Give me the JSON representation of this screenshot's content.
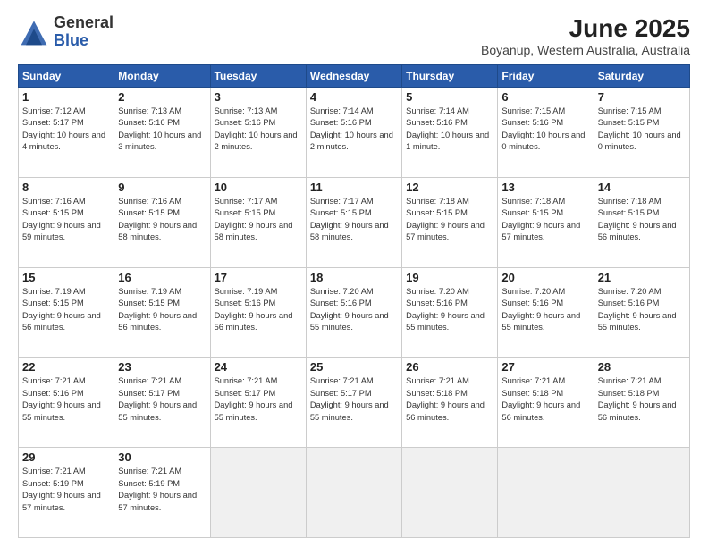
{
  "header": {
    "logo_general": "General",
    "logo_blue": "Blue",
    "month_year": "June 2025",
    "location": "Boyanup, Western Australia, Australia"
  },
  "days_of_week": [
    "Sunday",
    "Monday",
    "Tuesday",
    "Wednesday",
    "Thursday",
    "Friday",
    "Saturday"
  ],
  "weeks": [
    [
      {
        "day": 1,
        "sunrise": "7:12 AM",
        "sunset": "5:17 PM",
        "daylight": "10 hours and 4 minutes."
      },
      {
        "day": 2,
        "sunrise": "7:13 AM",
        "sunset": "5:16 PM",
        "daylight": "10 hours and 3 minutes."
      },
      {
        "day": 3,
        "sunrise": "7:13 AM",
        "sunset": "5:16 PM",
        "daylight": "10 hours and 2 minutes."
      },
      {
        "day": 4,
        "sunrise": "7:14 AM",
        "sunset": "5:16 PM",
        "daylight": "10 hours and 2 minutes."
      },
      {
        "day": 5,
        "sunrise": "7:14 AM",
        "sunset": "5:16 PM",
        "daylight": "10 hours and 1 minute."
      },
      {
        "day": 6,
        "sunrise": "7:15 AM",
        "sunset": "5:16 PM",
        "daylight": "10 hours and 0 minutes."
      },
      {
        "day": 7,
        "sunrise": "7:15 AM",
        "sunset": "5:15 PM",
        "daylight": "10 hours and 0 minutes."
      }
    ],
    [
      {
        "day": 8,
        "sunrise": "7:16 AM",
        "sunset": "5:15 PM",
        "daylight": "9 hours and 59 minutes."
      },
      {
        "day": 9,
        "sunrise": "7:16 AM",
        "sunset": "5:15 PM",
        "daylight": "9 hours and 58 minutes."
      },
      {
        "day": 10,
        "sunrise": "7:17 AM",
        "sunset": "5:15 PM",
        "daylight": "9 hours and 58 minutes."
      },
      {
        "day": 11,
        "sunrise": "7:17 AM",
        "sunset": "5:15 PM",
        "daylight": "9 hours and 58 minutes."
      },
      {
        "day": 12,
        "sunrise": "7:18 AM",
        "sunset": "5:15 PM",
        "daylight": "9 hours and 57 minutes."
      },
      {
        "day": 13,
        "sunrise": "7:18 AM",
        "sunset": "5:15 PM",
        "daylight": "9 hours and 57 minutes."
      },
      {
        "day": 14,
        "sunrise": "7:18 AM",
        "sunset": "5:15 PM",
        "daylight": "9 hours and 56 minutes."
      }
    ],
    [
      {
        "day": 15,
        "sunrise": "7:19 AM",
        "sunset": "5:15 PM",
        "daylight": "9 hours and 56 minutes."
      },
      {
        "day": 16,
        "sunrise": "7:19 AM",
        "sunset": "5:15 PM",
        "daylight": "9 hours and 56 minutes."
      },
      {
        "day": 17,
        "sunrise": "7:19 AM",
        "sunset": "5:16 PM",
        "daylight": "9 hours and 56 minutes."
      },
      {
        "day": 18,
        "sunrise": "7:20 AM",
        "sunset": "5:16 PM",
        "daylight": "9 hours and 55 minutes."
      },
      {
        "day": 19,
        "sunrise": "7:20 AM",
        "sunset": "5:16 PM",
        "daylight": "9 hours and 55 minutes."
      },
      {
        "day": 20,
        "sunrise": "7:20 AM",
        "sunset": "5:16 PM",
        "daylight": "9 hours and 55 minutes."
      },
      {
        "day": 21,
        "sunrise": "7:20 AM",
        "sunset": "5:16 PM",
        "daylight": "9 hours and 55 minutes."
      }
    ],
    [
      {
        "day": 22,
        "sunrise": "7:21 AM",
        "sunset": "5:16 PM",
        "daylight": "9 hours and 55 minutes."
      },
      {
        "day": 23,
        "sunrise": "7:21 AM",
        "sunset": "5:17 PM",
        "daylight": "9 hours and 55 minutes."
      },
      {
        "day": 24,
        "sunrise": "7:21 AM",
        "sunset": "5:17 PM",
        "daylight": "9 hours and 55 minutes."
      },
      {
        "day": 25,
        "sunrise": "7:21 AM",
        "sunset": "5:17 PM",
        "daylight": "9 hours and 55 minutes."
      },
      {
        "day": 26,
        "sunrise": "7:21 AM",
        "sunset": "5:18 PM",
        "daylight": "9 hours and 56 minutes."
      },
      {
        "day": 27,
        "sunrise": "7:21 AM",
        "sunset": "5:18 PM",
        "daylight": "9 hours and 56 minutes."
      },
      {
        "day": 28,
        "sunrise": "7:21 AM",
        "sunset": "5:18 PM",
        "daylight": "9 hours and 56 minutes."
      }
    ],
    [
      {
        "day": 29,
        "sunrise": "7:21 AM",
        "sunset": "5:19 PM",
        "daylight": "9 hours and 57 minutes."
      },
      {
        "day": 30,
        "sunrise": "7:21 AM",
        "sunset": "5:19 PM",
        "daylight": "9 hours and 57 minutes."
      },
      null,
      null,
      null,
      null,
      null
    ]
  ]
}
